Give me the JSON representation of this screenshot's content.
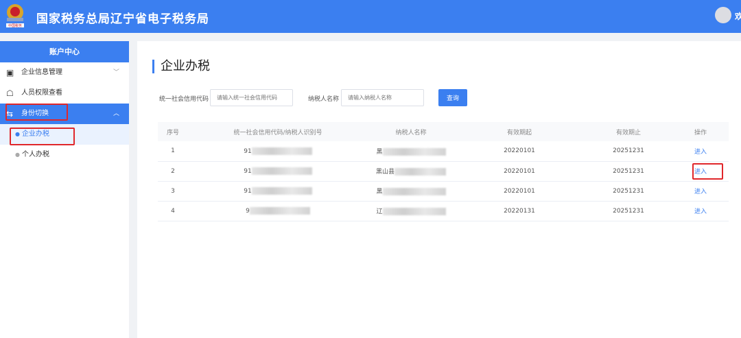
{
  "header": {
    "title": "国家税务总局辽宁省电子税务局",
    "user": "欢"
  },
  "sidebar": {
    "heading": "账户中心",
    "items": [
      {
        "label": "企业信息管理",
        "icon": "building-icon",
        "chevron": "﹀"
      },
      {
        "label": "人员权限查看",
        "icon": "user-lock-icon"
      },
      {
        "label": "身份切换",
        "icon": "switch-icon",
        "chevron": "︿"
      }
    ],
    "subitems": [
      {
        "label": "企业办税"
      },
      {
        "label": "个人办税"
      }
    ]
  },
  "main": {
    "title": "企业办税",
    "search": {
      "code_label": "统一社会信用代码",
      "code_placeholder": "请输入统一社会信用代码",
      "name_label": "纳税人名称",
      "name_placeholder": "请输入纳税人名称",
      "button": "查询"
    },
    "table": {
      "headers": [
        "序号",
        "统一社会信用代码/纳税人识别号",
        "纳税人名称",
        "有效期起",
        "有效期止",
        "操作"
      ],
      "rows": [
        {
          "no": "1",
          "code": "91",
          "name": "黑",
          "start": "20220101",
          "end": "20251231",
          "action": "进入"
        },
        {
          "no": "2",
          "code": "91",
          "name": "黑山县",
          "start": "20220101",
          "end": "20251231",
          "action": "进入"
        },
        {
          "no": "3",
          "code": "91",
          "name": "黑",
          "start": "20220101",
          "end": "20251231",
          "action": "进入"
        },
        {
          "no": "4",
          "code": "9",
          "name": "辽",
          "start": "20220131",
          "end": "20251231",
          "action": "进入"
        }
      ]
    }
  }
}
